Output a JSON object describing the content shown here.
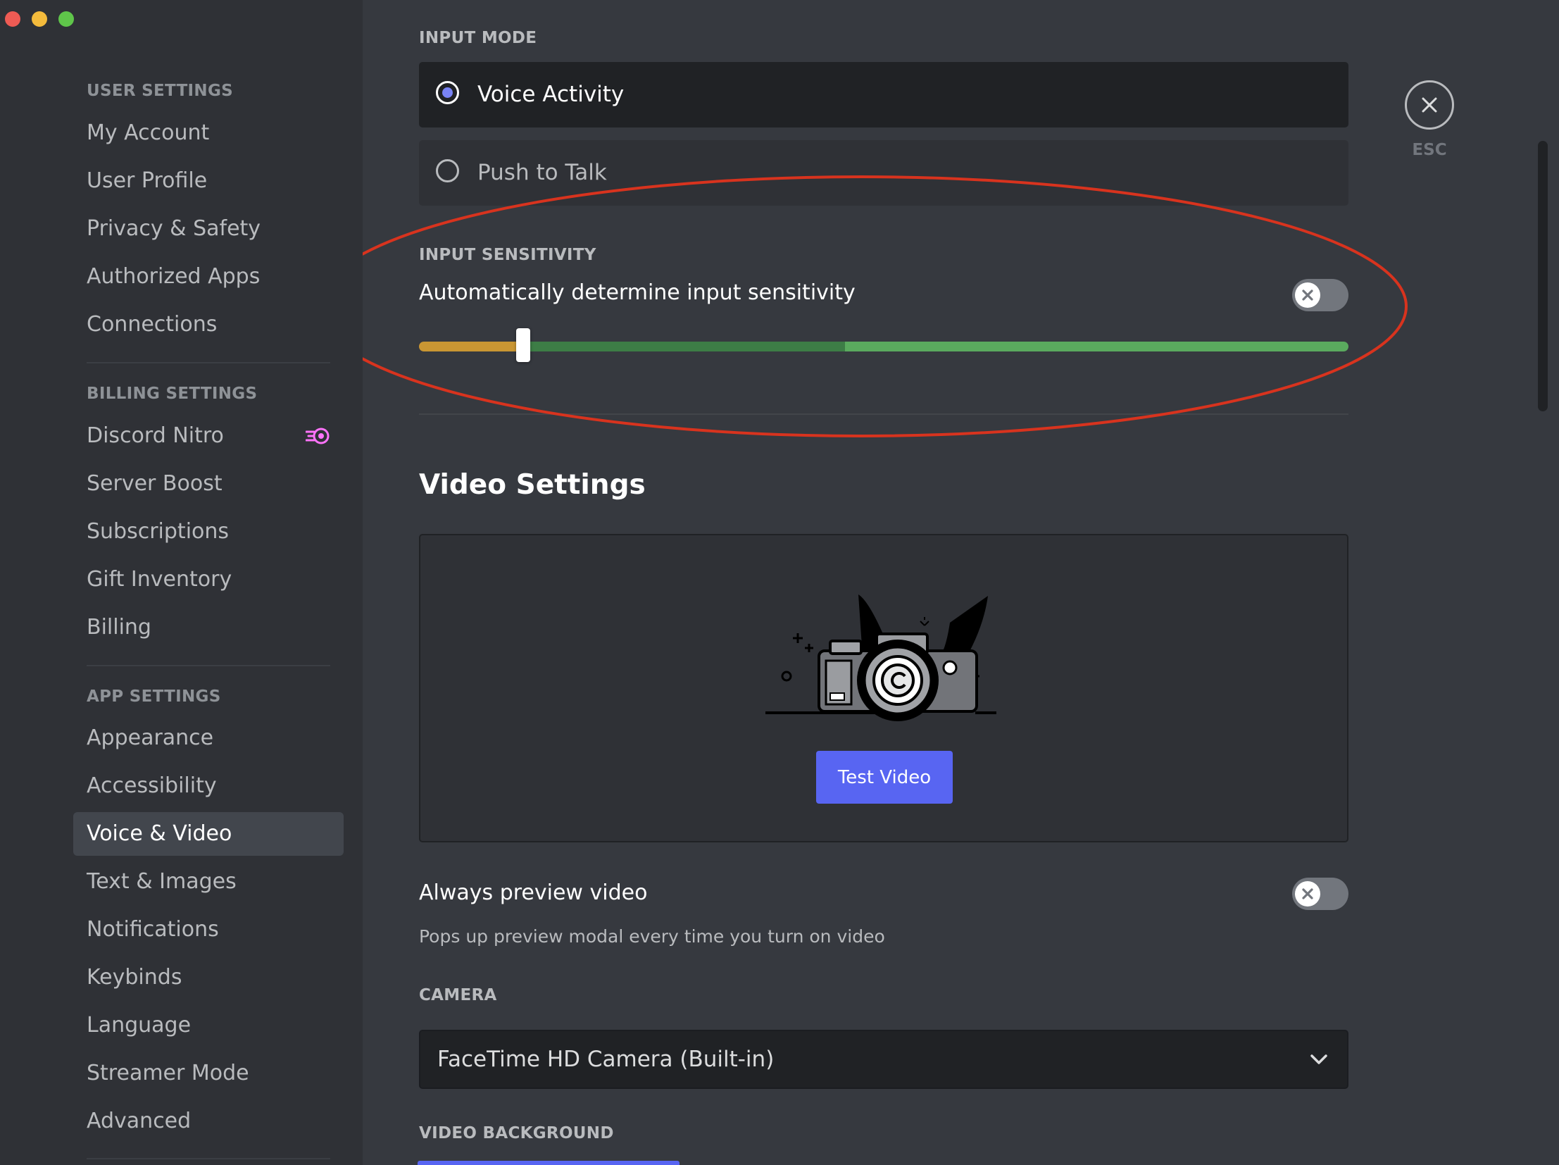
{
  "sidebar": {
    "user_settings_header": "USER SETTINGS",
    "user_items": [
      "My Account",
      "User Profile",
      "Privacy & Safety",
      "Authorized Apps",
      "Connections"
    ],
    "billing_settings_header": "BILLING SETTINGS",
    "billing_items": [
      "Discord Nitro",
      "Server Boost",
      "Subscriptions",
      "Gift Inventory",
      "Billing"
    ],
    "nitro_badge_icon": "nitro-icon",
    "app_settings_header": "APP SETTINGS",
    "app_items": [
      "Appearance",
      "Accessibility",
      "Voice & Video",
      "Text & Images",
      "Notifications",
      "Keybinds",
      "Language",
      "Streamer Mode",
      "Advanced"
    ],
    "active_item": "Voice & Video"
  },
  "input_mode": {
    "header": "INPUT MODE",
    "options": [
      "Voice Activity",
      "Push to Talk"
    ],
    "selected": "Voice Activity"
  },
  "input_sensitivity": {
    "header": "INPUT SENSITIVITY",
    "auto_label": "Automatically determine input sensitivity",
    "auto_enabled": false,
    "level_fraction": 0.11
  },
  "video_settings": {
    "title": "Video Settings",
    "test_button": "Test Video",
    "always_preview_label": "Always preview video",
    "always_preview_desc": "Pops up preview modal every time you turn on video",
    "always_preview_enabled": false,
    "camera_header": "CAMERA",
    "camera_value": "FaceTime HD Camera (Built-in)",
    "video_background_header": "VIDEO BACKGROUND"
  },
  "close": {
    "icon": "close-icon",
    "label": "ESC"
  },
  "colors": {
    "accent": "#5865f2",
    "radio_selected": "#7983f5",
    "slider_low": "#c99633",
    "slider_mid": "#3d7d46",
    "slider_high": "#5aaa5e",
    "annotation": "#d8331e"
  }
}
